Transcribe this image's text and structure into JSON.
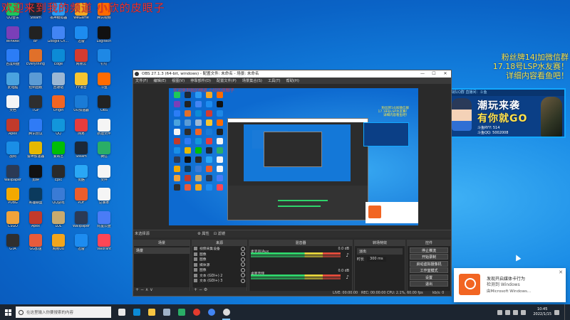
{
  "overlay_red_text": "欢迎来到我的频道 小欣的皮眼子",
  "promo": {
    "text_lines": [
      "粉丝牌14J加微信群",
      "17.18号LSP水友赛！",
      "详细内容看鱼吧！"
    ],
    "banner_top": "战队Q群 直播间：斗鱼",
    "banner_title1": "潮玩来袭",
    "banner_title2": "有你就GO",
    "banner_id1": "斗鱼RYY: 514",
    "banner_id2": "斗鱼QQ: 5002008"
  },
  "desktop_icons": [
    {
      "label": "QQ音乐",
      "color": "#1ec85b"
    },
    {
      "label": "Steam",
      "color": "#1b2838"
    },
    {
      "label": "夜神模拟器",
      "color": "#2b9af3"
    },
    {
      "label": "WeGame",
      "color": "#f5a623"
    },
    {
      "label": "腾讯视频",
      "color": "#ff6a00"
    },
    {
      "label": "WinRAR",
      "color": "#7a3fb8"
    },
    {
      "label": "BF",
      "color": "#222"
    },
    {
      "label": "Google Chrome",
      "color": "#4285f4"
    },
    {
      "label": "迅雷",
      "color": "#1d8cf0"
    },
    {
      "label": "Logitech",
      "color": "#111"
    },
    {
      "label": "百度网盘",
      "color": "#2c7df6"
    },
    {
      "label": "Everything",
      "color": "#e0702a"
    },
    {
      "label": "Edge",
      "color": "#0c8bd6"
    },
    {
      "label": "网易云",
      "color": "#d43b2f"
    },
    {
      "label": "钉钉",
      "color": "#1e88e5"
    },
    {
      "label": "此电脑",
      "color": "#4aa3df"
    },
    {
      "label": "控制面板",
      "color": "#5b9bd5"
    },
    {
      "label": "回收站",
      "color": "#9bb7d4"
    },
    {
      "label": "YY语音",
      "color": "#f7c530"
    },
    {
      "label": "斗鱼",
      "color": "#ff6b00"
    },
    {
      "label": "文档",
      "color": "#f5f5f5"
    },
    {
      "label": "TGP",
      "color": "#2e2e2e"
    },
    {
      "label": "Origin",
      "color": "#f26522"
    },
    {
      "label": "UU加速器",
      "color": "#1a7bd6"
    },
    {
      "label": "OBS",
      "color": "#222"
    },
    {
      "label": "Apex",
      "color": "#c23a2b"
    },
    {
      "label": "腾讯会议",
      "color": "#2f7bf6"
    },
    {
      "label": "QQ",
      "color": "#1296db"
    },
    {
      "label": "网易",
      "color": "#e63c3c"
    },
    {
      "label": "新建文件",
      "color": "#f5f5f5"
    },
    {
      "label": "战网",
      "color": "#1a8ee6"
    },
    {
      "label": "雷神加速器",
      "color": "#e6b800"
    },
    {
      "label": "爱奇艺",
      "color": "#00be06"
    },
    {
      "label": "Steam",
      "color": "#1b2838"
    },
    {
      "label": "微信",
      "color": "#2aae67"
    },
    {
      "label": "Wallpaper",
      "color": "#2b3a55"
    },
    {
      "label": "剪映",
      "color": "#111"
    },
    {
      "label": "Epic",
      "color": "#2a2a2a"
    },
    {
      "label": "优酷",
      "color": "#2aa7f5"
    },
    {
      "label": "文件",
      "color": "#f5f5f5"
    },
    {
      "label": "PUBG",
      "color": "#f2a900"
    },
    {
      "label": "英雄联盟",
      "color": "#0b3a5d"
    },
    {
      "label": "QQ游戏",
      "color": "#3a7bd5"
    },
    {
      "label": "PDF",
      "color": "#ec5d2a"
    },
    {
      "label": "记事本",
      "color": "#f5f5f5"
    },
    {
      "label": "CSGO",
      "color": "#f1a33a"
    },
    {
      "label": "Apex",
      "color": "#c23a2b"
    },
    {
      "label": "LOL",
      "color": "#c8aa6e"
    },
    {
      "label": "Wallpaper",
      "color": "#2b3a55"
    },
    {
      "label": "阿里云盘",
      "color": "#4a7cf6"
    },
    {
      "label": "GTA",
      "color": "#2f2f2f"
    },
    {
      "label": "GG加速",
      "color": "#e85b3a"
    },
    {
      "label": "网易UU",
      "color": "#f3a51b"
    },
    {
      "label": "迅雷",
      "color": "#1d8cf0"
    },
    {
      "label": "Valorant",
      "color": "#ff4655"
    }
  ],
  "obs": {
    "title": "OBS 27.1.3 (64-bit, windows) - 配置文件: 未命名 - 场景: 未命名",
    "menu": [
      "文件(F)",
      "编辑(E)",
      "视图(V)",
      "停靠部件(D)",
      "配置文件(P)",
      "场景集合(S)",
      "工具(T)",
      "帮助(H)"
    ],
    "source_label": "未选择源",
    "scenebar_buttons": [
      "⚙ 属性",
      "⊡ 滤镜"
    ],
    "panels": {
      "scenes": "场景",
      "sources": "来源",
      "mixer": "混音器",
      "transitions": "转场特效",
      "controls": "控件"
    },
    "scene_item": "场景",
    "sources": [
      "视频采集设备",
      "图像",
      "图像",
      "媒体源",
      "图像",
      "文本 (GDI+) 2",
      "文本 (GDI+) 3"
    ],
    "mixer": [
      {
        "name": "麦克风/Aux",
        "db": "0.0 dB"
      },
      {
        "name": "桌面音频",
        "db": "0.0 dB"
      }
    ],
    "transition": "淡出",
    "duration_label": "时长",
    "duration_value": "300 ms",
    "controls": [
      "停止推流",
      "开始录制",
      "启动虚拟摄像机",
      "工作室模式",
      "设置",
      "退出"
    ],
    "status": {
      "live": "LIVE: 00:00:00",
      "rec": "REC: 00:00:00",
      "cpu": "CPU: 2.1%, 60.00 fps",
      "kbps": "kb/s: 0"
    }
  },
  "notification": {
    "title": "发现开启媒体卡行为",
    "line2": "检测到 Windows",
    "line3": "由Microsoft Windows..."
  },
  "taskbar": {
    "search_placeholder": "在这里输入你要搜索的内容",
    "time": "10:45",
    "date": "2022/1/15",
    "pinned": [
      {
        "name": "task-view",
        "color": "#e8e8e8",
        "active": false
      },
      {
        "name": "edge",
        "color": "#0c8bd6",
        "active": false
      },
      {
        "name": "explorer",
        "color": "#f5c542",
        "active": false
      },
      {
        "name": "steam",
        "color": "#9fb3c8",
        "active": false
      },
      {
        "name": "wechat",
        "color": "#2aae67",
        "active": false
      },
      {
        "name": "netease",
        "color": "#e33b2e",
        "active": false
      },
      {
        "name": "chrome",
        "color": "#4285f4",
        "active": false
      },
      {
        "name": "obs",
        "color": "#dcdcdc",
        "active": true
      }
    ]
  }
}
